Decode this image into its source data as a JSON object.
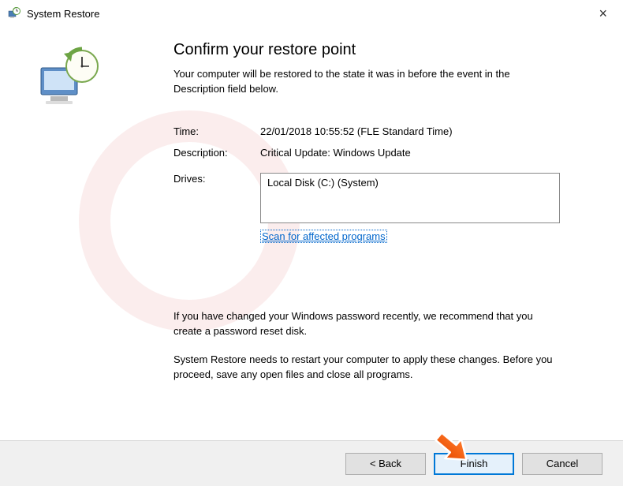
{
  "window": {
    "title": "System Restore"
  },
  "heading": "Confirm your restore point",
  "intro": "Your computer will be restored to the state it was in before the event in the Description field below.",
  "fields": {
    "time_label": "Time:",
    "time_value": "22/01/2018 10:55:52 (FLE Standard Time)",
    "description_label": "Description:",
    "description_value": "Critical Update: Windows Update",
    "drives_label": "Drives:",
    "drives_value": "Local Disk (C:) (System)"
  },
  "scan_link": "Scan for affected programs",
  "note_password": "If you have changed your Windows password recently, we recommend that you create a password reset disk.",
  "note_restart": "System Restore needs to restart your computer to apply these changes. Before you proceed, save any open files and close all programs.",
  "buttons": {
    "back": "< Back",
    "finish": "Finish",
    "cancel": "Cancel"
  }
}
